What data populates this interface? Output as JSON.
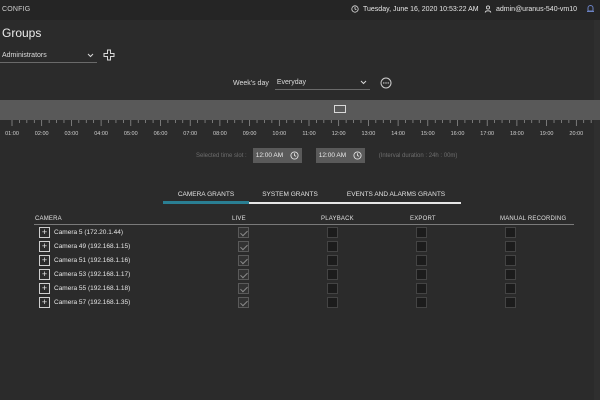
{
  "topbar": {
    "app_title": "CONFIG",
    "datetime": "Tuesday, June 16, 2020 10:53:22 AM",
    "user": "admin@uranus-540-vm10"
  },
  "page": {
    "title": "Groups",
    "group_select_value": "Administrators"
  },
  "schedule": {
    "week_label": "Week's day",
    "week_value": "Everyday",
    "hours": [
      "01:00",
      "02:00",
      "03:00",
      "04:00",
      "05:00",
      "06:00",
      "07:00",
      "08:00",
      "09:00",
      "10:00",
      "11:00",
      "12:00",
      "13:00",
      "14:00",
      "15:00",
      "16:00",
      "17:00",
      "18:00",
      "19:00",
      "20:00"
    ],
    "slot_label": "Selected time slot :",
    "slot_start": "12:00 AM",
    "slot_end": "12:00 AM",
    "interval": "(Interval duration : 24h : 00m)"
  },
  "tabs": [
    {
      "label": "CAMERA GRANTS",
      "active": true
    },
    {
      "label": "SYSTEM GRANTS",
      "active": false
    },
    {
      "label": "EVENTS AND ALARMS GRANTS",
      "active": false
    }
  ],
  "table": {
    "headers": {
      "camera": "CAMERA",
      "live": "LIVE",
      "playback": "PLAYBACK",
      "export": "EXPORT",
      "manual": "MANUAL RECORDING"
    },
    "rows": [
      {
        "name": "Camera 5 (172.20.1.44)",
        "live": true,
        "playback": false,
        "export": false,
        "manual": false
      },
      {
        "name": "Camera 49 (192.168.1.15)",
        "live": true,
        "playback": false,
        "export": false,
        "manual": false
      },
      {
        "name": "Camera 51 (192.168.1.16)",
        "live": true,
        "playback": false,
        "export": false,
        "manual": false
      },
      {
        "name": "Camera 53 (192.168.1.17)",
        "live": true,
        "playback": false,
        "export": false,
        "manual": false
      },
      {
        "name": "Camera 55 (192.168.1.18)",
        "live": true,
        "playback": false,
        "export": false,
        "manual": false
      },
      {
        "name": "Camera 57 (192.168.1.35)",
        "live": true,
        "playback": false,
        "export": false,
        "manual": false
      }
    ]
  },
  "icons": {
    "clock": "clock-icon",
    "user": "user-icon",
    "add": "add-icon",
    "more": "more-icon",
    "chevron": "chevron-down-icon"
  }
}
